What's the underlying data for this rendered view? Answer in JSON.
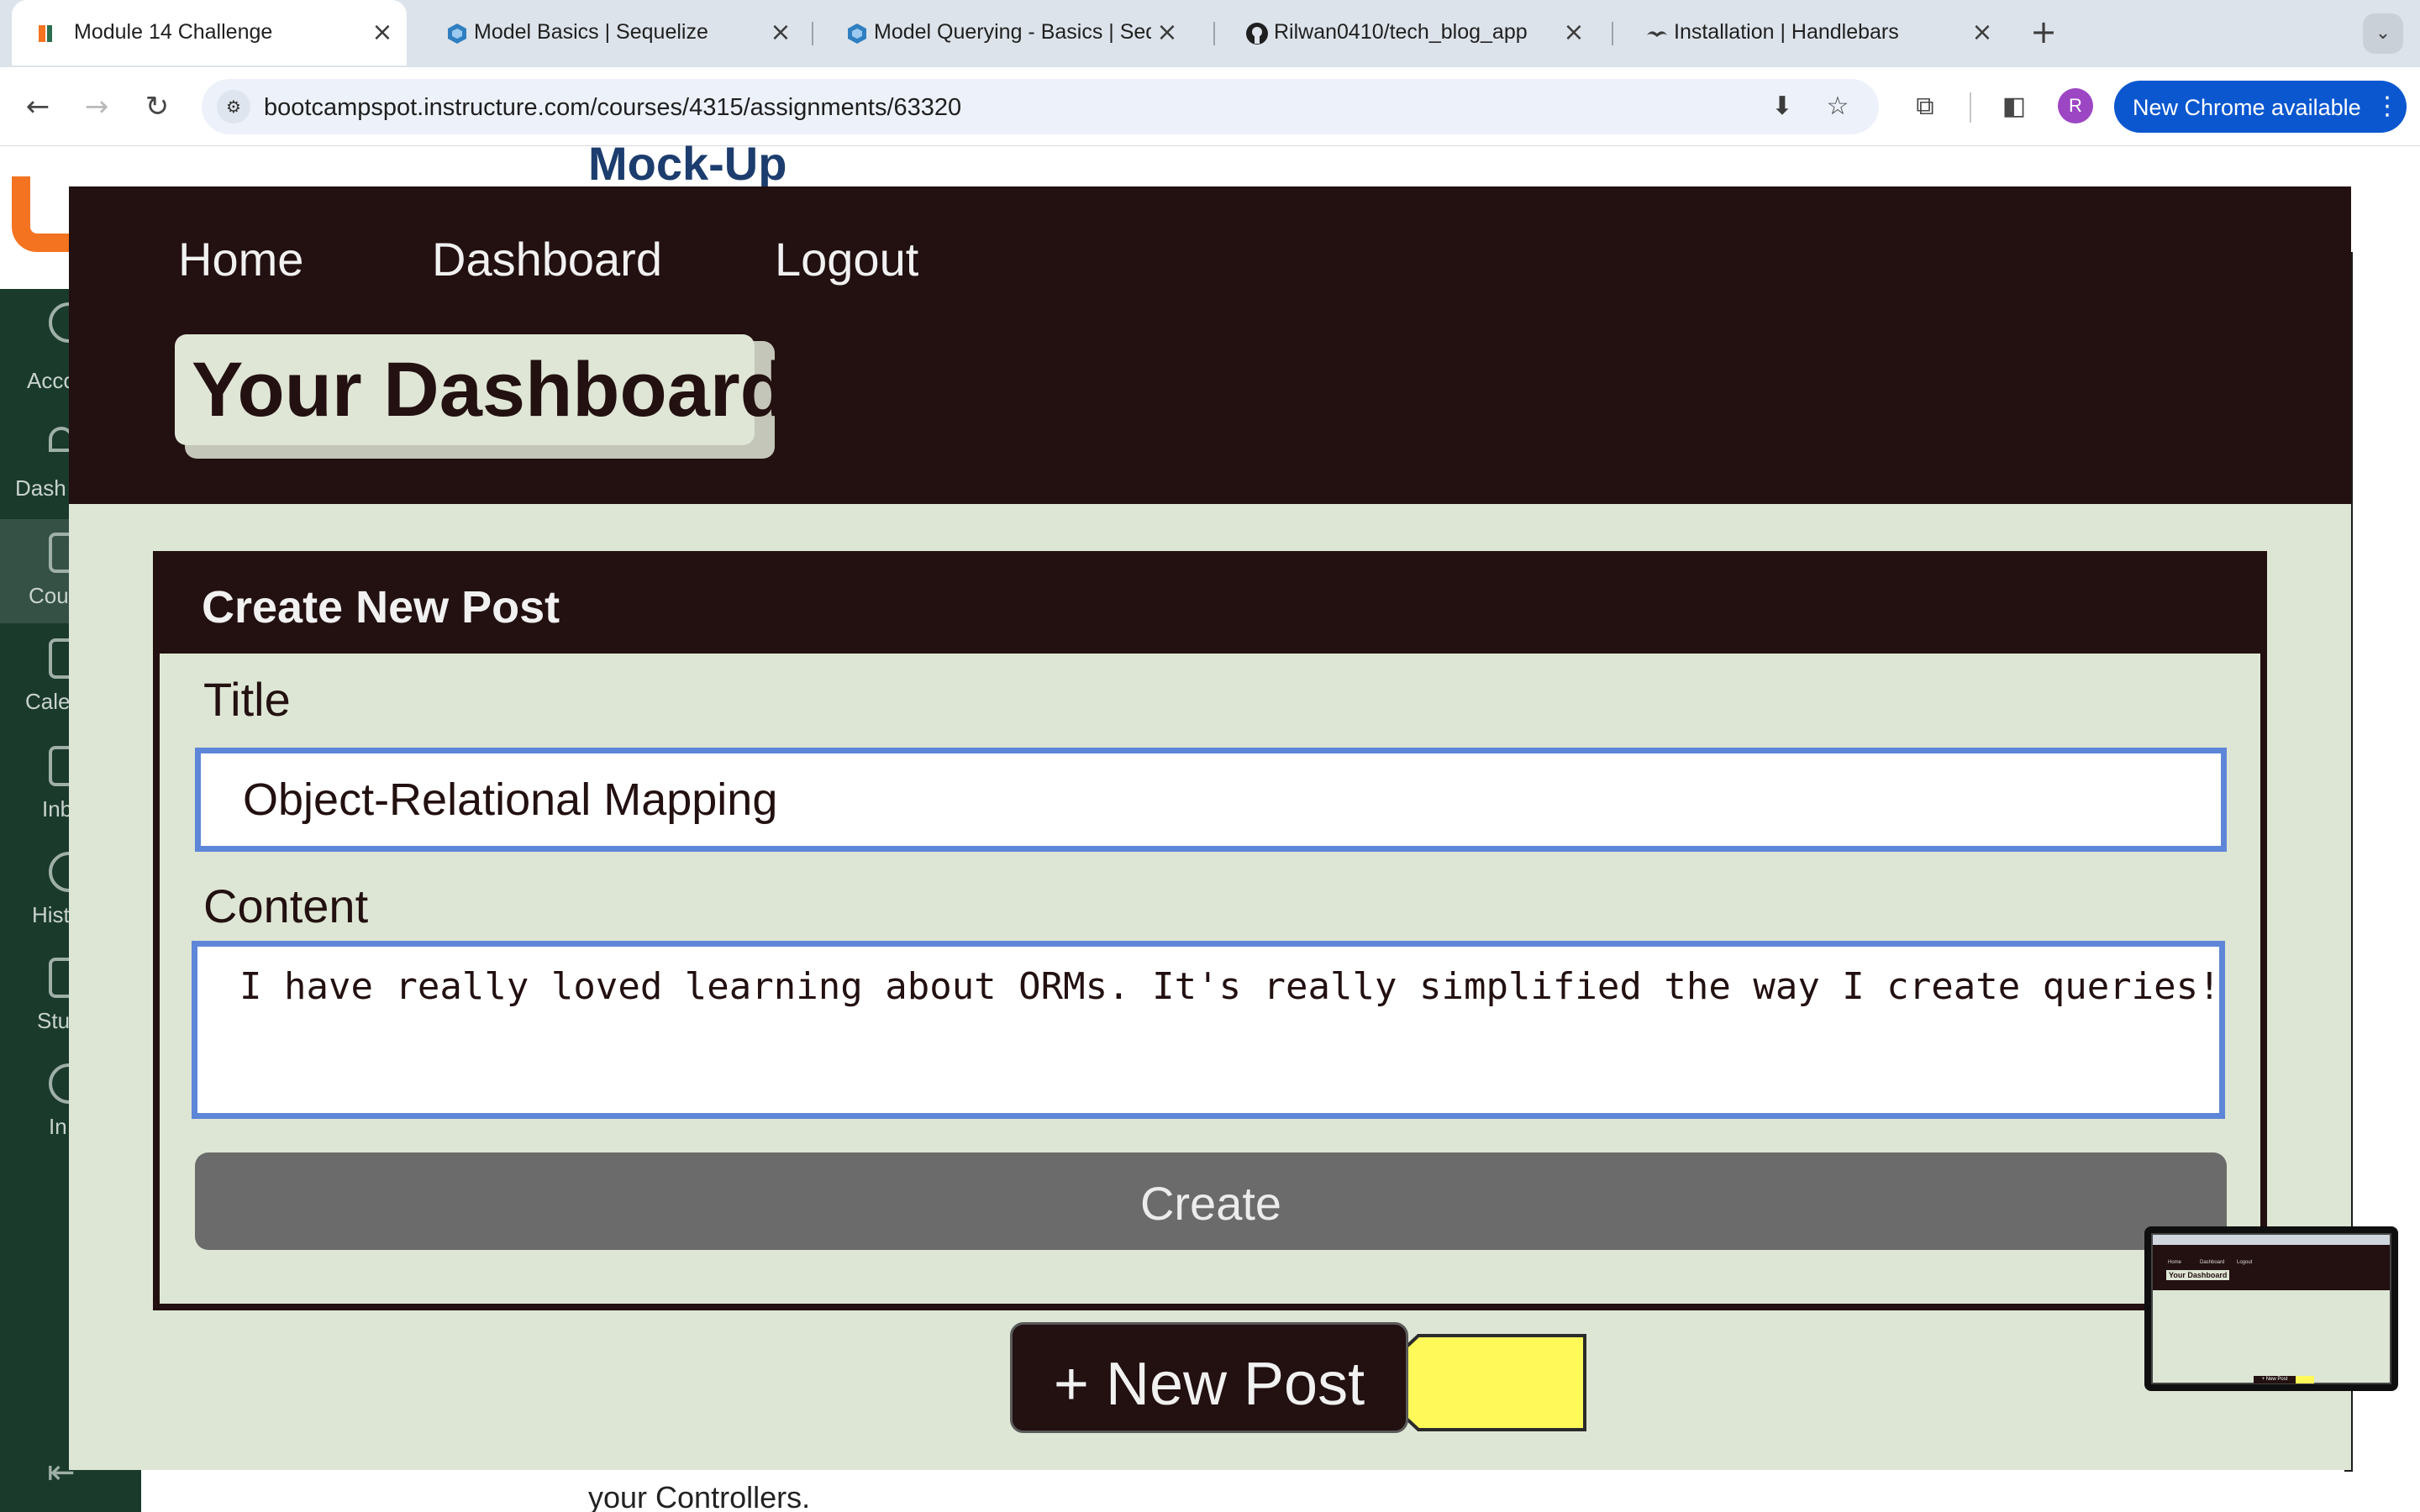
{
  "browser": {
    "tabs": [
      {
        "title": "Module 14 Challenge",
        "icon": "canvas-favicon",
        "active": true
      },
      {
        "title": "Model Basics | Sequelize",
        "icon": "sequelize-favicon"
      },
      {
        "title": "Model Querying - Basics | Seq",
        "icon": "sequelize-favicon"
      },
      {
        "title": "Rilwan0410/tech_blog_app",
        "icon": "github-favicon"
      },
      {
        "title": "Installation | Handlebars",
        "icon": "handlebars-favicon"
      }
    ],
    "close_glyph": "×",
    "new_tab_glyph": "+",
    "tab_search_glyph": "⌄",
    "back_glyph": "←",
    "forward_glyph": "→",
    "reload_glyph": "↻",
    "site_info_glyph": "⚙",
    "url": "bootcampspot.instructure.com/courses/4315/assignments/63320",
    "install_glyph": "⬇",
    "bookmark_glyph": "☆",
    "extensions_glyph": "⧉",
    "sidepanel_glyph": "◧",
    "profile_initial": "R",
    "update_label": "New Chrome available",
    "kebab_glyph": "⋮"
  },
  "canvas_page": {
    "heading": "Mock-Up",
    "body_fragment": "your Controllers.",
    "rail_labels": [
      "Acco",
      "Dash",
      "Cou",
      "Cale",
      "Inb",
      "Hist",
      "Stu",
      "In"
    ],
    "collapse_glyph": "⇤"
  },
  "mockup": {
    "nav": [
      "Home",
      "Dashboard",
      "Logout"
    ],
    "dashboard_title": "Your Dashboard",
    "form": {
      "heading": "Create New Post",
      "title_label": "Title",
      "title_value": "Object-Relational Mapping",
      "content_label": "Content",
      "content_value": "I have really loved learning about ORMs. It's really simplified the way I create queries!",
      "submit_label": "Create"
    },
    "new_post_label": "+ New Post",
    "annotation_arrow_color": "#fff95a"
  },
  "thumbnail": {
    "nav": [
      "Home",
      "Dashboard",
      "Logout"
    ],
    "title": "Your Dashboard",
    "button": "+ New Post"
  },
  "colors": {
    "app_header": "#231010",
    "app_background": "#dde6d4",
    "input_focus_border": "#5e86d8",
    "create_button": "#6b6b6b",
    "chrome_update_pill": "#0b57d0",
    "canvas_rail": "#1a3a2c",
    "canvas_logo": "#f47321"
  }
}
